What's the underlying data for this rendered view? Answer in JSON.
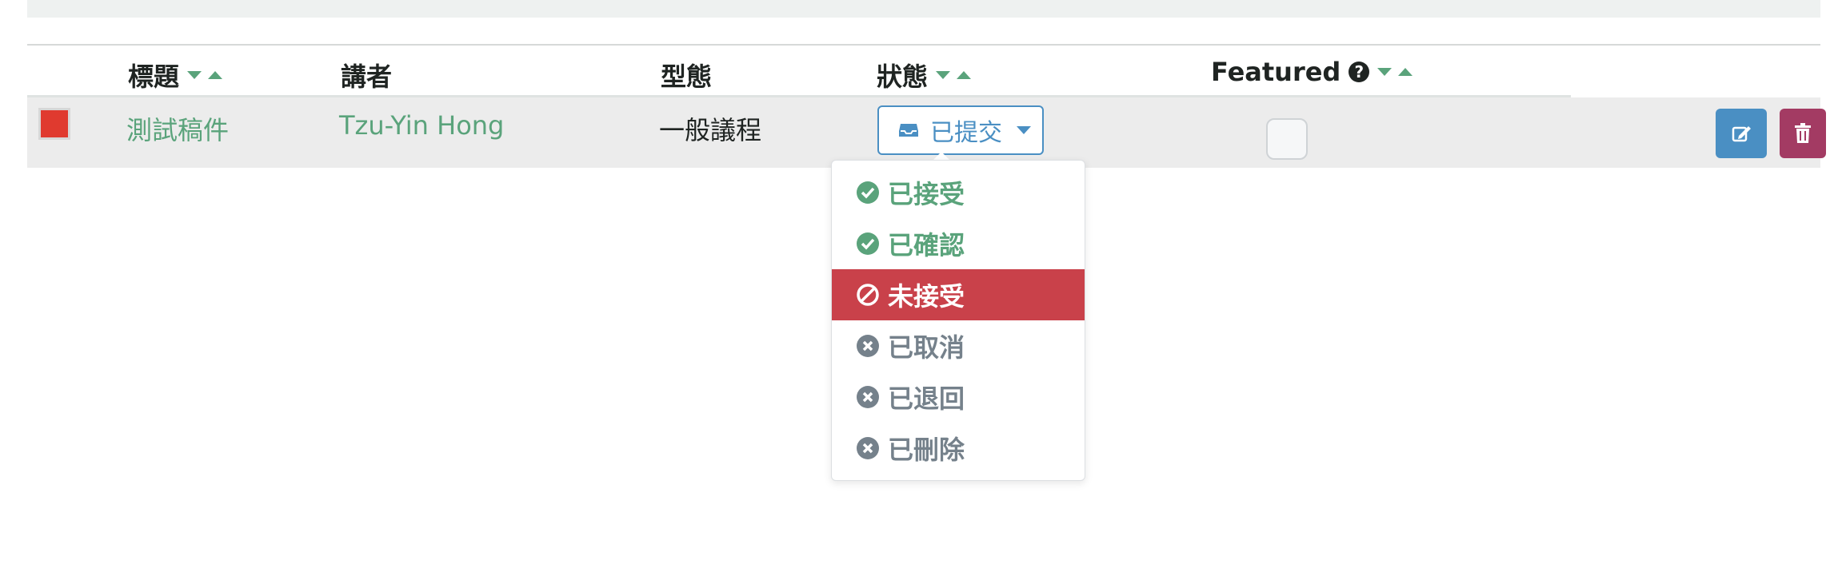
{
  "table": {
    "headers": {
      "title": "標題",
      "speaker": "講者",
      "type": "型態",
      "status": "狀態",
      "featured": "Featured"
    },
    "row": {
      "title": "測試稿件",
      "speaker": "Tzu-Yin Hong",
      "type": "一般議程",
      "status_selected": "已提交",
      "color_square": "#e03a2f"
    }
  },
  "status_dropdown": {
    "items": [
      {
        "label": "已接受",
        "icon": "check-circle-icon",
        "color": "#5aa37b"
      },
      {
        "label": "已確認",
        "icon": "check-circle-icon",
        "color": "#5aa37b"
      },
      {
        "label": "未接受",
        "icon": "ban-icon",
        "color": "#ffffff",
        "active": true
      },
      {
        "label": "已取消",
        "icon": "times-circle-icon",
        "color": "#75818b"
      },
      {
        "label": "已退回",
        "icon": "times-circle-icon",
        "color": "#75818b"
      },
      {
        "label": "已刪除",
        "icon": "times-circle-icon",
        "color": "#75818b"
      }
    ]
  },
  "colors": {
    "accent_green": "#5aa37b",
    "edit_blue": "#4a8fc3",
    "delete_maroon": "#a33b63",
    "active_red": "#c9414a"
  }
}
